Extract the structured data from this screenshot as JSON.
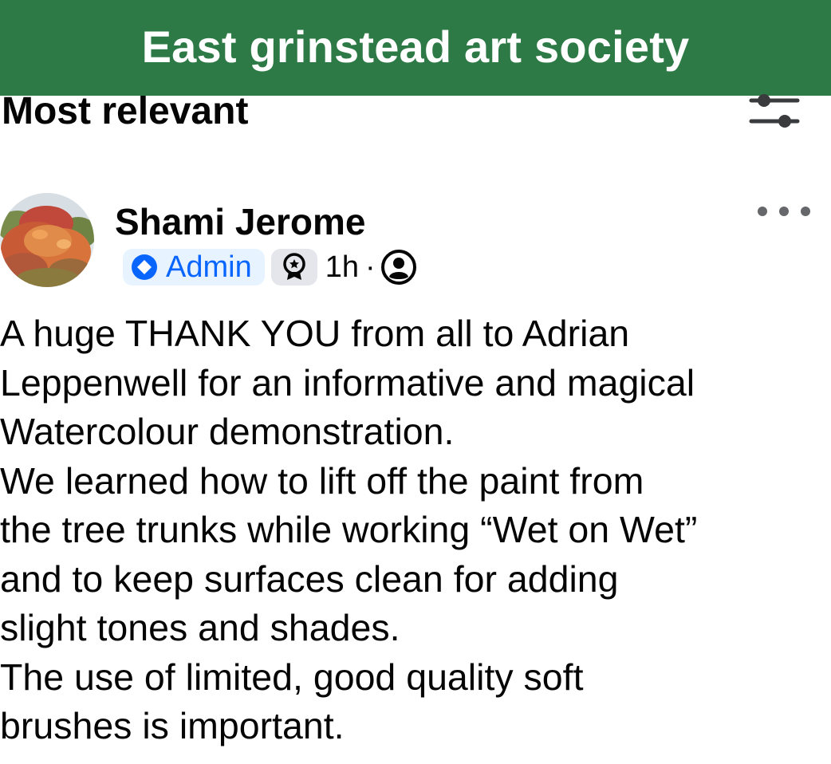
{
  "banner": {
    "title": "East grinstead art society",
    "background_color": "#2e7a46"
  },
  "comments": {
    "sort_label": "Most relevant",
    "filter_icon": "sliders-icon"
  },
  "post": {
    "author": "Shami Jerome",
    "role_badge": "Admin",
    "role_icon": "admin-diamond-icon",
    "award_icon": "award-medal-icon",
    "time": "1h",
    "separator": "·",
    "privacy_icon": "members-only-icon",
    "more_icon": "more-dots-icon",
    "body_lines": [
      "A huge THANK YOU from all to Adrian",
      "Leppenwell for an informative and magical",
      "Watercolour demonstration.",
      "We learned how to lift off the paint from",
      "the tree trunks while working “Wet on Wet”",
      "and to keep surfaces clean for adding",
      "slight tones and shades.",
      "The use of limited, good quality soft",
      "brushes is important."
    ]
  },
  "colors": {
    "accent_blue": "#0866ff",
    "badge_bg": "#e7f3ff",
    "icon_gray": "#65676b"
  }
}
